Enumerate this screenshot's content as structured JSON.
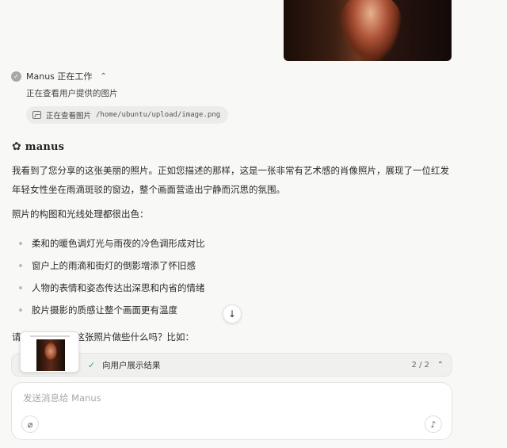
{
  "status": {
    "title": "Manus 正在工作",
    "substatus": "正在查看用户提供的图片",
    "tool_action": "正在查看图片",
    "tool_path": "/home/ubuntu/upload/image.png"
  },
  "brand": {
    "name": "manus"
  },
  "message": {
    "paragraph1": "我看到了您分享的这张美丽的照片。正如您描述的那样，这是一张非常有艺术感的肖像照片，展现了一位红发年轻女性坐在雨滴斑驳的窗边，整个画面营造出宁静而沉思的氛围。",
    "paragraph2": "照片的构图和光线处理都很出色：",
    "bullets": [
      "柔和的暖色调灯光与雨夜的冷色调形成对比",
      "窗户上的雨滴和街灯的倒影增添了怀旧感",
      "人物的表情和姿态传达出深思和内省的情绪",
      "胶片摄影的质感让整个画面更有温度"
    ],
    "paragraph3": "请问您想要我对这张照片做些什么吗？比如："
  },
  "task_bar": {
    "label": "向用户展示结果",
    "count": "2 / 2"
  },
  "composer": {
    "placeholder": "发送消息给 Manus"
  },
  "icons": {
    "status": "check-circle-icon",
    "tool": "image-icon",
    "scroll": "arrow-down-icon",
    "attach": "paperclip-icon",
    "mic": "microphone-icon"
  }
}
